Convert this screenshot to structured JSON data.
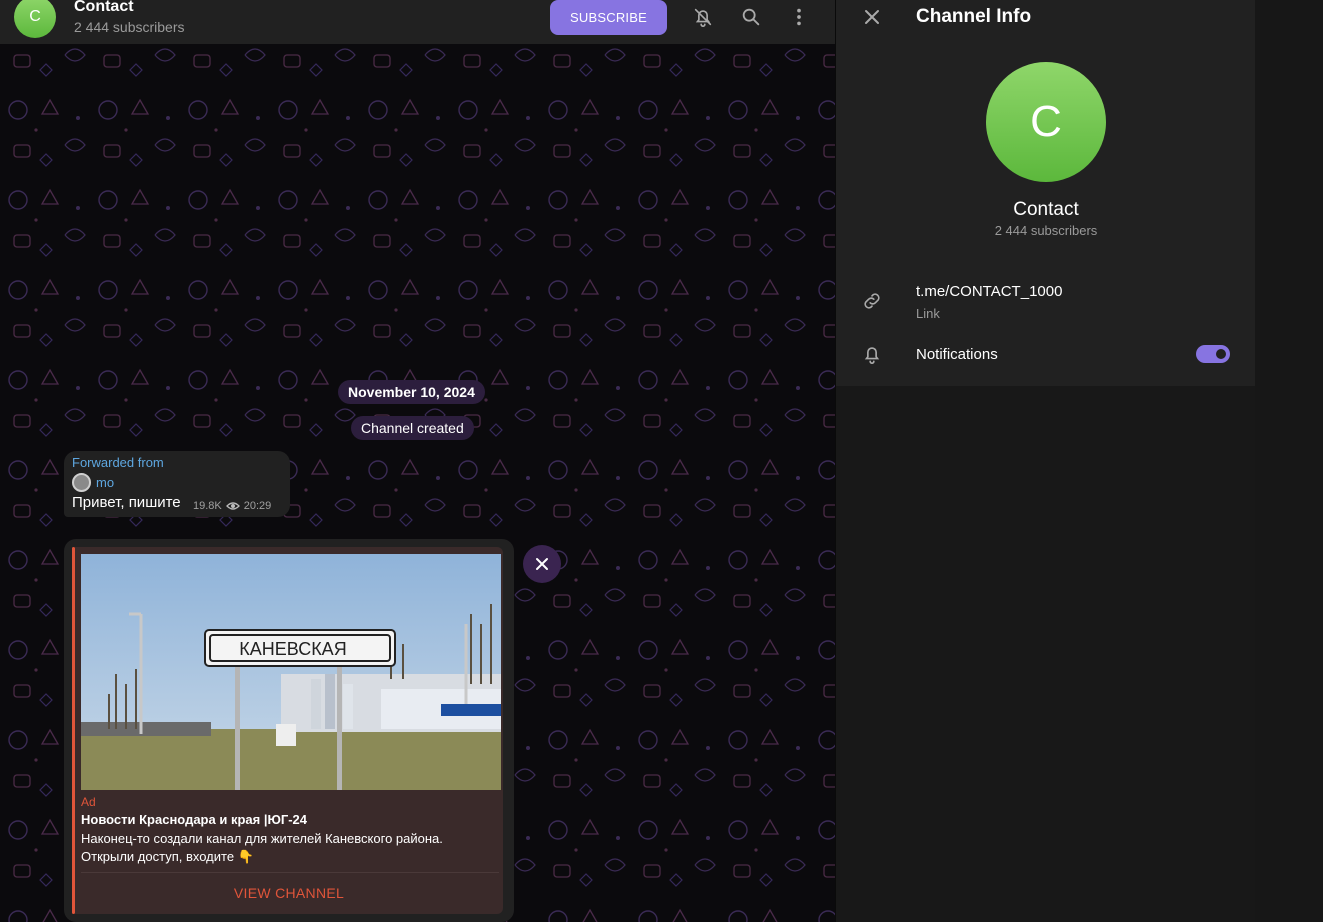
{
  "header": {
    "avatar_letter": "C",
    "title": "Contact",
    "subtitle": "2 444 subscribers",
    "subscribe_label": "SUBSCRIBE"
  },
  "chat": {
    "date_pill": "November 10, 2024",
    "service_pill": "Channel created",
    "message": {
      "forwarded_label": "Forwarded from",
      "from_name": "mo",
      "text": "Привет, пишите",
      "views": "19.8K",
      "time": "20:29"
    },
    "ad": {
      "image_sign_text": "КАНЕВСКАЯ",
      "label": "Ad",
      "title": "Новости Краснодара и края |ЮГ-24",
      "desc_line1": "Наконец-то создали канал для жителей Каневского района.",
      "desc_line2": "Открыли  доступ, входите 👇",
      "cta": "VIEW CHANNEL"
    }
  },
  "panel": {
    "title": "Channel Info",
    "avatar_letter": "C",
    "name": "Contact",
    "subscribers": "2 444 subscribers",
    "link_value": "t.me/CONTACT_1000",
    "link_label": "Link",
    "notifications_label": "Notifications",
    "notifications_on": true
  },
  "colors": {
    "accent": "#8774e1",
    "ad_accent": "#e0553a",
    "avatar_green": "#6cc24a"
  }
}
